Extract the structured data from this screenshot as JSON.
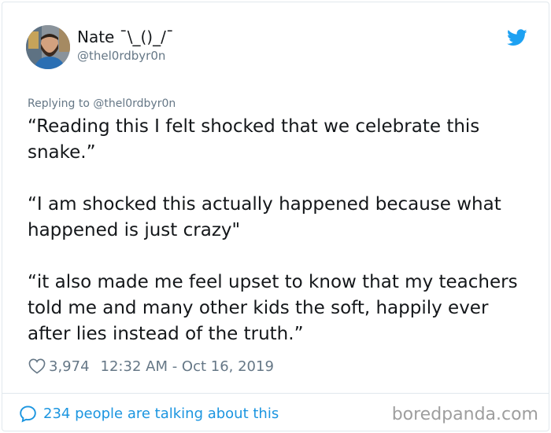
{
  "author": {
    "display_name": "Nate ¯\\_()_/¯",
    "handle": "@thel0rdbyr0n"
  },
  "reply_to": "Replying to @thel0rdbyr0n",
  "tweet": {
    "paragraphs": [
      "“Reading this I felt shocked that we celebrate this snake.”",
      "“I am shocked this actually happened because what happened is just crazy\"",
      "“it also made me feel upset to know that my teachers told me and many other kids the soft, happily ever after lies instead of the truth.”"
    ]
  },
  "meta": {
    "like_count": "3,974",
    "timestamp": "12:32 AM - Oct 16, 2019"
  },
  "footer": {
    "conversation_link": "234 people are talking about this"
  },
  "watermark": "boredpanda.com",
  "colors": {
    "twitter_blue": "#1b95e0",
    "secondary_text": "#657786",
    "primary_text": "#14171a",
    "border": "#e1e8ed"
  },
  "icons": {
    "brand": "twitter-bird-icon",
    "like": "heart-icon",
    "conversation": "speech-bubble-icon"
  }
}
